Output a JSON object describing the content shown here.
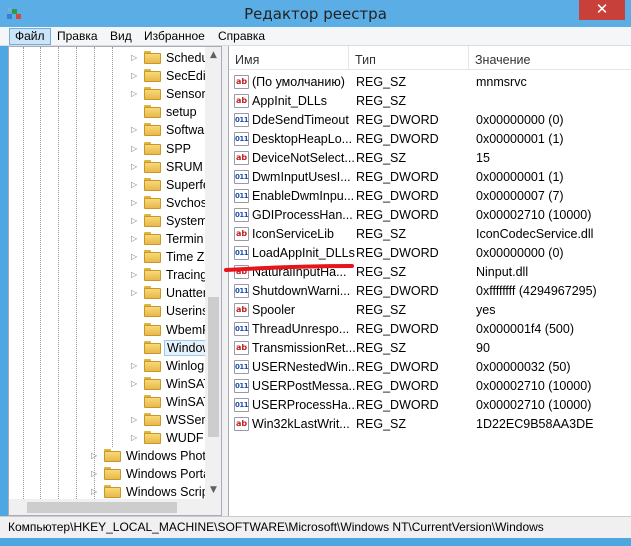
{
  "window": {
    "title": "Редактор реестра",
    "close_glyph": "✕"
  },
  "menu": [
    "Файл",
    "Правка",
    "Вид",
    "Избранное",
    "Справка"
  ],
  "tree": {
    "items": [
      {
        "label": "Schedu",
        "level": 2,
        "expander": "▷",
        "selected": false
      },
      {
        "label": "SecEdit",
        "level": 2,
        "expander": "▷",
        "selected": false
      },
      {
        "label": "Sensor",
        "level": 2,
        "expander": "▷",
        "selected": false
      },
      {
        "label": "setup",
        "level": 2,
        "expander": "",
        "selected": false
      },
      {
        "label": "Softwa",
        "level": 2,
        "expander": "▷",
        "selected": false
      },
      {
        "label": "SPP",
        "level": 2,
        "expander": "▷",
        "selected": false
      },
      {
        "label": "SRUM",
        "level": 2,
        "expander": "▷",
        "selected": false
      },
      {
        "label": "Superfe",
        "level": 2,
        "expander": "▷",
        "selected": false
      },
      {
        "label": "Svchos",
        "level": 2,
        "expander": "▷",
        "selected": false
      },
      {
        "label": "System",
        "level": 2,
        "expander": "▷",
        "selected": false
      },
      {
        "label": "Termin",
        "level": 2,
        "expander": "▷",
        "selected": false
      },
      {
        "label": "Time Z",
        "level": 2,
        "expander": "▷",
        "selected": false
      },
      {
        "label": "Tracing",
        "level": 2,
        "expander": "▷",
        "selected": false
      },
      {
        "label": "Unatter",
        "level": 2,
        "expander": "▷",
        "selected": false
      },
      {
        "label": "Userins",
        "level": 2,
        "expander": "",
        "selected": false
      },
      {
        "label": "WbemF",
        "level": 2,
        "expander": "",
        "selected": false
      },
      {
        "label": "Window",
        "level": 2,
        "expander": "",
        "selected": true
      },
      {
        "label": "Winlog",
        "level": 2,
        "expander": "▷",
        "selected": false
      },
      {
        "label": "WinSAT",
        "level": 2,
        "expander": "▷",
        "selected": false
      },
      {
        "label": "WinSAT",
        "level": 2,
        "expander": "",
        "selected": false
      },
      {
        "label": "WSServ",
        "level": 2,
        "expander": "▷",
        "selected": false
      },
      {
        "label": "WUDF",
        "level": 2,
        "expander": "▷",
        "selected": false
      },
      {
        "label": "Windows Phot",
        "level": 1,
        "expander": "▷",
        "selected": false
      },
      {
        "label": "Windows Porta",
        "level": 1,
        "expander": "▷",
        "selected": false
      },
      {
        "label": "Windows Scrip",
        "level": 1,
        "expander": "▷",
        "selected": false
      }
    ]
  },
  "list": {
    "columns": {
      "name": "Имя",
      "type": "Тип",
      "data": "Значение"
    },
    "rows": [
      {
        "icon": "sz",
        "name": "(По умолчанию)",
        "type": "REG_SZ",
        "data": "mnmsrvc"
      },
      {
        "icon": "sz",
        "name": "AppInit_DLLs",
        "type": "REG_SZ",
        "data": ""
      },
      {
        "icon": "dword",
        "name": "DdeSendTimeout",
        "type": "REG_DWORD",
        "data": "0x00000000 (0)"
      },
      {
        "icon": "dword",
        "name": "DesktopHeapLo...",
        "type": "REG_DWORD",
        "data": "0x00000001 (1)"
      },
      {
        "icon": "sz",
        "name": "DeviceNotSelect...",
        "type": "REG_SZ",
        "data": "15"
      },
      {
        "icon": "dword",
        "name": "DwmInputUsesI...",
        "type": "REG_DWORD",
        "data": "0x00000001 (1)"
      },
      {
        "icon": "dword",
        "name": "EnableDwmInpu...",
        "type": "REG_DWORD",
        "data": "0x00000007 (7)"
      },
      {
        "icon": "dword",
        "name": "GDIProcessHan...",
        "type": "REG_DWORD",
        "data": "0x00002710 (10000)"
      },
      {
        "icon": "sz",
        "name": "IconServiceLib",
        "type": "REG_SZ",
        "data": "IconCodecService.dll"
      },
      {
        "icon": "dword",
        "name": "LoadAppInit_DLLs",
        "type": "REG_DWORD",
        "data": "0x00000000 (0)"
      },
      {
        "icon": "sz",
        "name": "NaturalInputHa...",
        "type": "REG_SZ",
        "data": "Ninput.dll"
      },
      {
        "icon": "dword",
        "name": "ShutdownWarni...",
        "type": "REG_DWORD",
        "data": "0xffffffff (4294967295)"
      },
      {
        "icon": "sz",
        "name": "Spooler",
        "type": "REG_SZ",
        "data": "yes"
      },
      {
        "icon": "dword",
        "name": "ThreadUnrespo...",
        "type": "REG_DWORD",
        "data": "0x000001f4 (500)"
      },
      {
        "icon": "sz",
        "name": "TransmissionRet...",
        "type": "REG_SZ",
        "data": "90"
      },
      {
        "icon": "dword",
        "name": "USERNestedWin...",
        "type": "REG_DWORD",
        "data": "0x00000032 (50)"
      },
      {
        "icon": "dword",
        "name": "USERPostMessa...",
        "type": "REG_DWORD",
        "data": "0x00002710 (10000)"
      },
      {
        "icon": "dword",
        "name": "USERProcessHa...",
        "type": "REG_DWORD",
        "data": "0x00002710 (10000)"
      },
      {
        "icon": "sz",
        "name": "Win32kLastWrit...",
        "type": "REG_SZ",
        "data": "1D22EC9B58AA3DE"
      }
    ],
    "icon_text": {
      "sz": "ab",
      "dword": "011"
    }
  },
  "status": {
    "path": "Компьютер\\HKEY_LOCAL_MACHINE\\SOFTWARE\\Microsoft\\Windows NT\\CurrentVersion\\Windows"
  },
  "colors": {
    "annotation": "#e8141c",
    "selection": "#e5f1fb"
  }
}
